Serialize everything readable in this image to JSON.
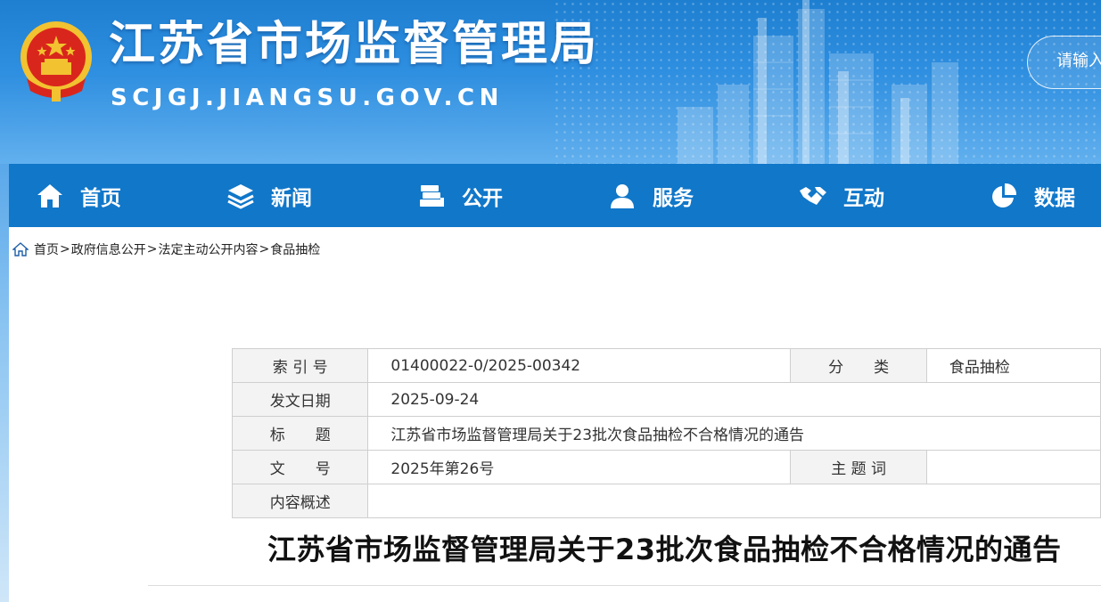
{
  "header": {
    "site_title": "江苏省市场监督管理局",
    "site_domain": "SCJGJ.JIANGSU.GOV.CN",
    "search_placeholder": "请输入",
    "brand_color": "#1e7fd1"
  },
  "nav": {
    "items": [
      {
        "label": "首页",
        "icon": "home-icon"
      },
      {
        "label": "新闻",
        "icon": "layers-icon"
      },
      {
        "label": "公开",
        "icon": "books-icon"
      },
      {
        "label": "服务",
        "icon": "user-icon"
      },
      {
        "label": "互动",
        "icon": "handshake-icon"
      },
      {
        "label": "数据",
        "icon": "pie-chart-icon"
      }
    ],
    "color": "#1077c9"
  },
  "breadcrumb": {
    "items": [
      "首页",
      "政府信息公开",
      "法定主动公开内容",
      "食品抽检"
    ],
    "separator": ">"
  },
  "info": {
    "index_label": "索 引 号",
    "index_value": "01400022-0/2025-00342",
    "category_label": "分　　类",
    "category_value": "食品抽检",
    "date_label": "发文日期",
    "date_value": "2025-09-24",
    "title_label": "标　　题",
    "title_value": "江苏省市场监督管理局关于23批次食品抽检不合格情况的通告",
    "docno_label": "文　　号",
    "docno_value": "2025年第26号",
    "keywords_label": "主 题 词",
    "keywords_value": "",
    "summary_label": "内容概述",
    "summary_value": ""
  },
  "article": {
    "title": "江苏省市场监督管理局关于23批次食品抽检不合格情况的通告"
  }
}
